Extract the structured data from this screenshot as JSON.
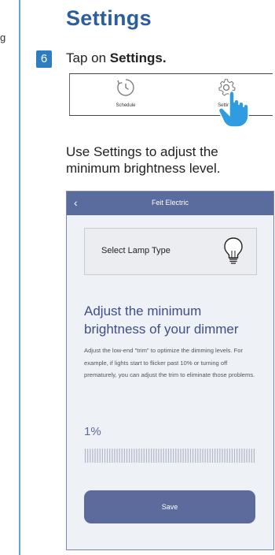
{
  "left_fragment": "g",
  "heading": "Settings",
  "step": {
    "number": "6",
    "prefix": "Tap on ",
    "emphasis": "Settings."
  },
  "tabs": {
    "schedule": "Schedule",
    "settings": "Settings"
  },
  "caption": "Use Settings to adjust the minimum brightness level.",
  "app": {
    "title": "Feit Electric",
    "back_icon": "chevron-left-icon",
    "lamp_type_label": "Select Lamp Type",
    "lamp_icon": "lightbulb-icon",
    "adjust_title": "Adjust the minimum brightness of your dimmer",
    "adjust_body": "Adjust the low-end \"trim\" to optimize the dimming levels. For example, if lights start to flicker past 10% or turning off prematurely, you can adjust the trim to eliminate those problems.",
    "trim_value": "1%",
    "trim_level": 0.01,
    "save_label": "Save"
  },
  "colors": {
    "heading": "#2c5d9c",
    "badge": "#2f7dc0",
    "app_bar": "#5a6b9e",
    "accent": "#3f4f86",
    "button": "#5d6a9c"
  }
}
